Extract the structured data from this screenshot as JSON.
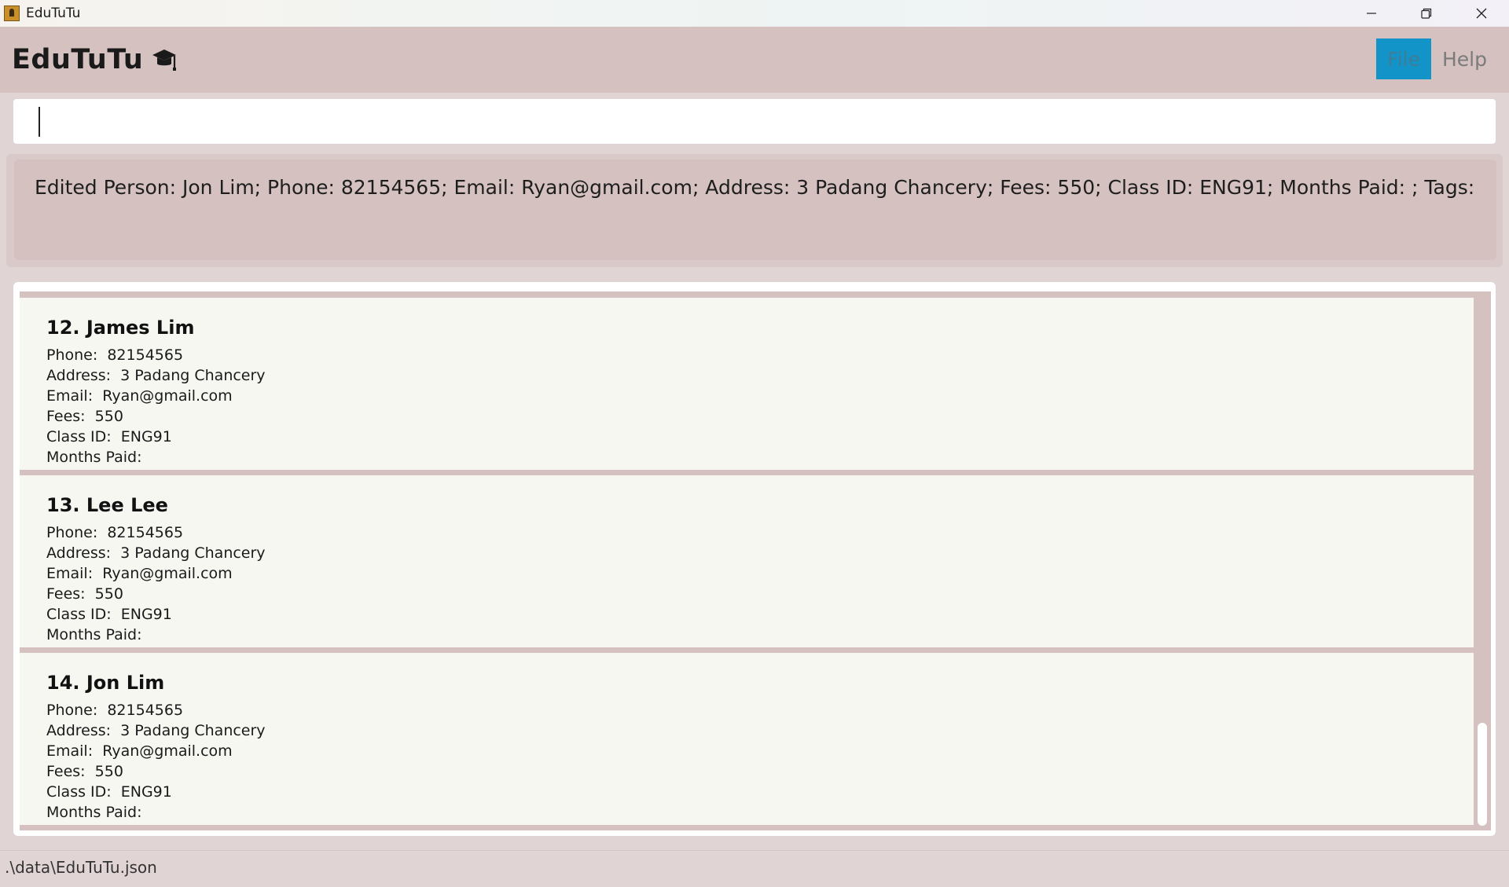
{
  "window": {
    "title": "EduTuTu",
    "controls": {
      "minimize": "minimize-icon",
      "restore": "restore-icon",
      "close": "close-icon"
    }
  },
  "header": {
    "brand": "EduTuTu",
    "brand_icon": "graduation-cap-icon",
    "menu": [
      {
        "label": "File",
        "active": true
      },
      {
        "label": "Help",
        "active": false
      }
    ]
  },
  "command": {
    "value": "",
    "placeholder": ""
  },
  "result": {
    "text": "Edited Person: Jon Lim; Phone: 82154565; Email: Ryan@gmail.com; Address: 3 Padang Chancery; Fees: 550; Class ID: ENG91; Months Paid: ; Tags:"
  },
  "persons": [
    {
      "name": "12. James Lim",
      "phone": "Phone:  82154565",
      "address": "Address:  3 Padang Chancery",
      "email": "Email:  Ryan@gmail.com",
      "fees": "Fees:  550",
      "class_id": "Class ID:  ENG91",
      "months_paid": "Months Paid:"
    },
    {
      "name": "13. Lee Lee",
      "phone": "Phone:  82154565",
      "address": "Address:  3 Padang Chancery",
      "email": "Email:  Ryan@gmail.com",
      "fees": "Fees:  550",
      "class_id": "Class ID:  ENG91",
      "months_paid": "Months Paid:"
    },
    {
      "name": "14. Jon Lim",
      "phone": "Phone:  82154565",
      "address": "Address:  3 Padang Chancery",
      "email": "Email:  Ryan@gmail.com",
      "fees": "Fees:  550",
      "class_id": "Class ID:  ENG91",
      "months_paid": "Months Paid:"
    }
  ],
  "status": {
    "path": ".\\data\\EduTuTu.json"
  },
  "colors": {
    "header_bg": "#d4c1c0",
    "card_bg": "#f7f7f2",
    "menu_active": "#1294c9",
    "window_bg": "#e0d4d4"
  }
}
